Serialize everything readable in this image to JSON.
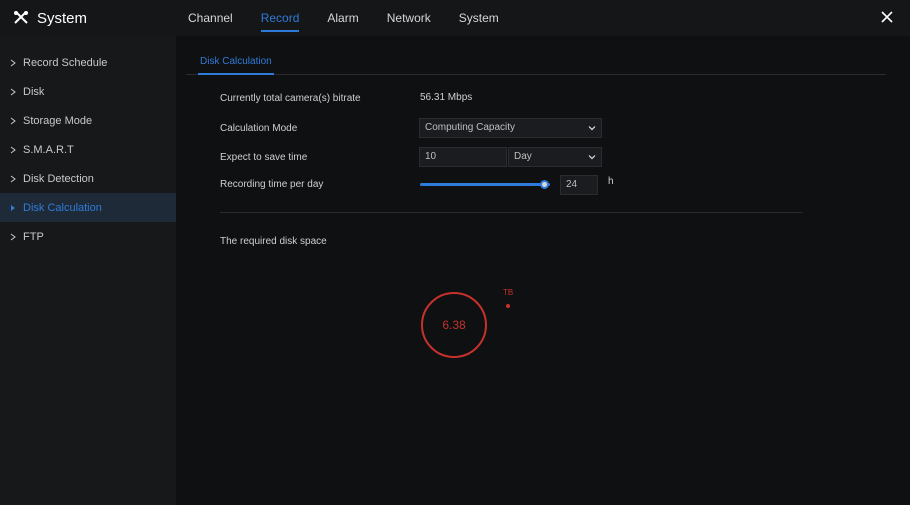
{
  "app": {
    "title": "System"
  },
  "nav": {
    "tabs": [
      {
        "label": "Channel",
        "active": false
      },
      {
        "label": "Record",
        "active": true
      },
      {
        "label": "Alarm",
        "active": false
      },
      {
        "label": "Network",
        "active": false
      },
      {
        "label": "System",
        "active": false
      }
    ]
  },
  "sidebar": {
    "items": [
      {
        "label": "Record Schedule"
      },
      {
        "label": "Disk"
      },
      {
        "label": "Storage Mode"
      },
      {
        "label": "S.M.A.R.T"
      },
      {
        "label": "Disk Detection"
      },
      {
        "label": "Disk Calculation",
        "active": true
      },
      {
        "label": "FTP"
      }
    ]
  },
  "subtab": {
    "label": "Disk Calculation"
  },
  "form": {
    "bitrate_label": "Currently total camera(s) bitrate",
    "bitrate_value": "56.31 Mbps",
    "mode_label": "Calculation Mode",
    "mode_value": "Computing Capacity",
    "save_time_label": "Expect to save time",
    "save_time_value": "10",
    "save_time_unit": "Day",
    "per_day_label": "Recording time per day",
    "per_day_value": "24",
    "per_day_unit": "h",
    "per_day_fraction": 1.0
  },
  "result": {
    "label": "The required disk space",
    "value": "6.38",
    "unit": "TB"
  },
  "colors": {
    "accent": "#2f7bd9",
    "result": "#c6312c"
  },
  "icons": {
    "brand": "tools-icon",
    "close": "close-icon",
    "arrow": "triangle-right-icon",
    "chevron": "chevron-down-icon"
  }
}
